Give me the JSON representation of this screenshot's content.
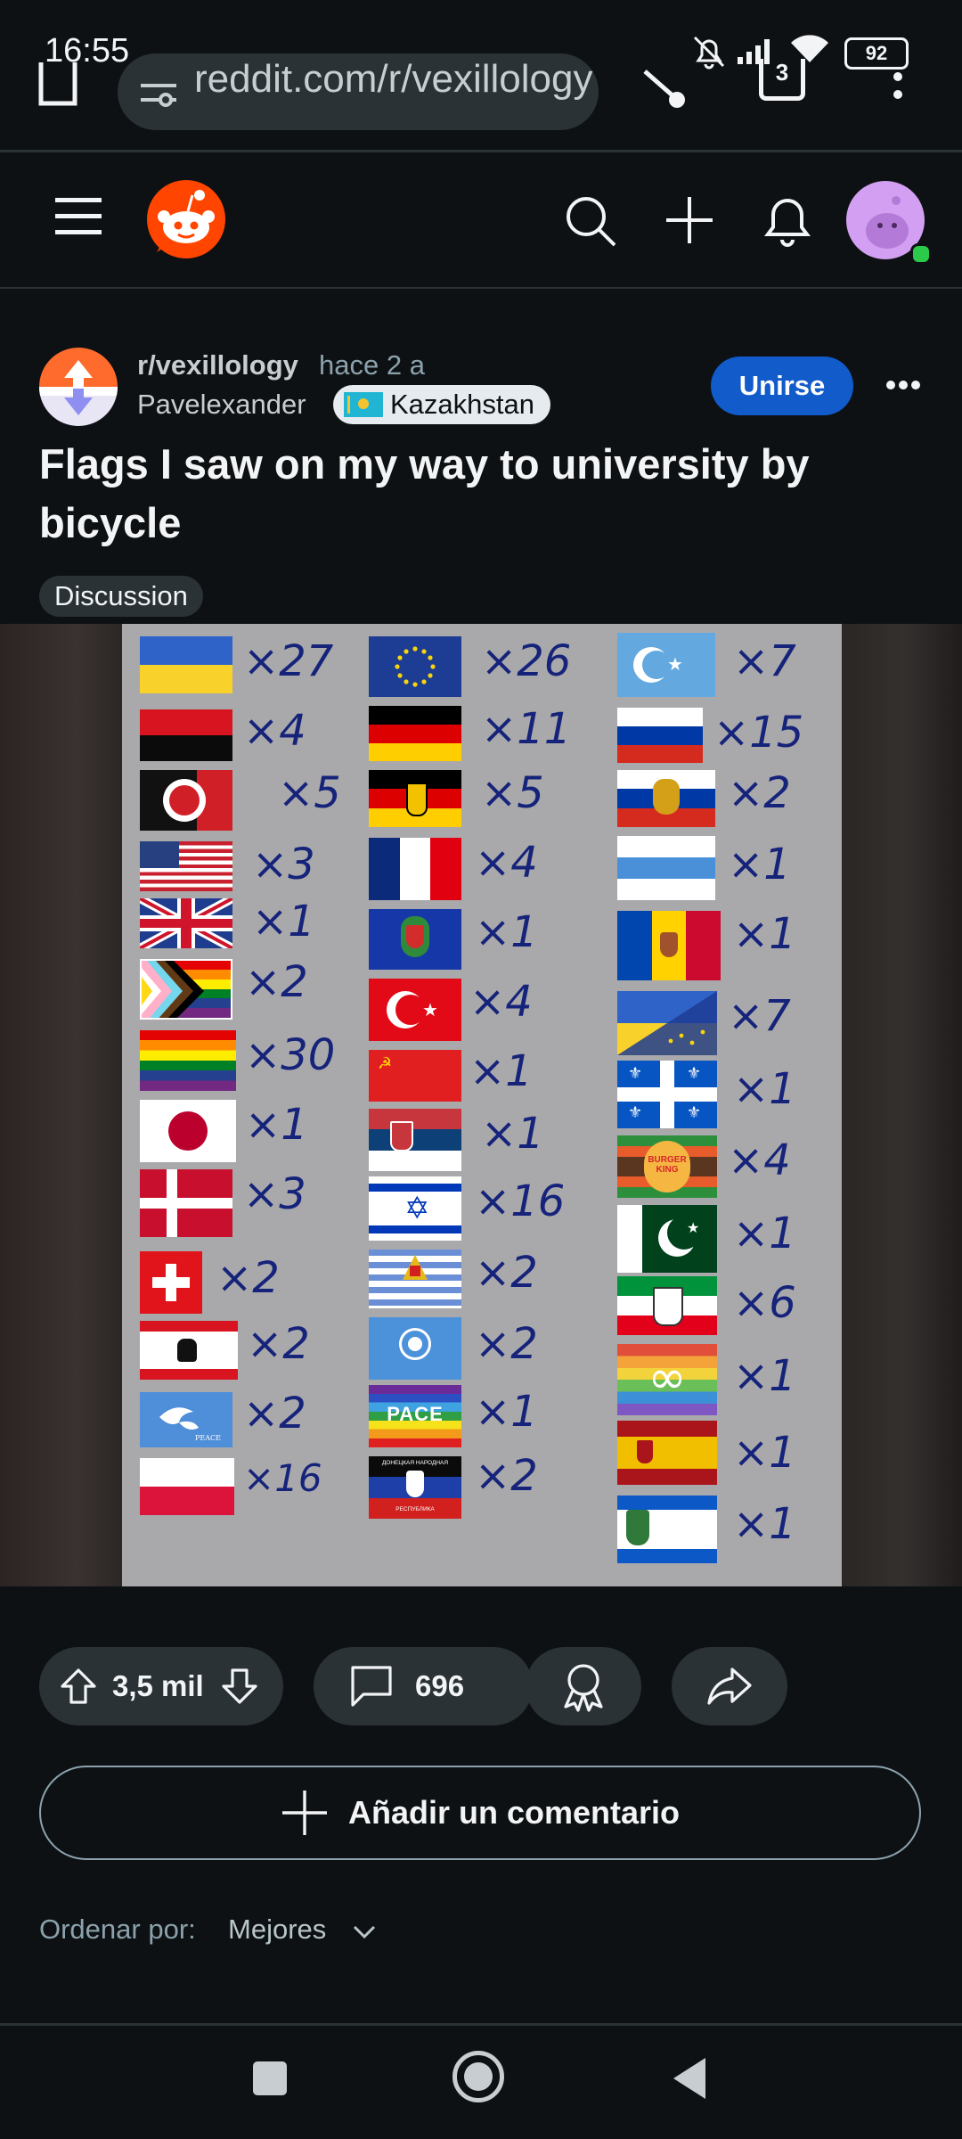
{
  "status_bar": {
    "time": "16:55",
    "battery": "92",
    "icons": [
      "mute-bell-icon",
      "signal-icon",
      "wifi-icon",
      "battery-icon"
    ]
  },
  "browser": {
    "url": "reddit.com/r/vexillology",
    "icons": [
      "home-icon",
      "tune-icon",
      "share-icon",
      "tabs-icon",
      "more-vert-icon"
    ],
    "tab_count": "3"
  },
  "reddit_header": {
    "icons": [
      "menu-icon",
      "reddit-logo",
      "search-icon",
      "plus-icon",
      "bell-icon",
      "avatar"
    ]
  },
  "post": {
    "subreddit": "r/vexillology",
    "time": "hace 2 a",
    "author": "Pavelexander",
    "flair": "Kazakhstan",
    "join_label": "Unirse",
    "title": "Flags I saw on my way to university by bicycle",
    "tag": "Discussion"
  },
  "flag_tally": {
    "col1": [
      {
        "flag": "Ukraine",
        "count": "×27"
      },
      {
        "flag": "Red-black",
        "count": "×4"
      },
      {
        "flag": "Antifa",
        "count": "×5"
      },
      {
        "flag": "USA",
        "count": "×3"
      },
      {
        "flag": "UK",
        "count": "×1"
      },
      {
        "flag": "Progress pride",
        "count": "×2"
      },
      {
        "flag": "Rainbow",
        "count": "×30"
      },
      {
        "flag": "Japan",
        "count": "×1"
      },
      {
        "flag": "Denmark",
        "count": "×3"
      },
      {
        "flag": "Switzerland",
        "count": "×2"
      },
      {
        "flag": "Berlin",
        "count": "×2"
      },
      {
        "flag": "Peace dove",
        "count": "×2"
      },
      {
        "flag": "Poland",
        "count": "×16"
      }
    ],
    "col2": [
      {
        "flag": "EU",
        "count": "×26"
      },
      {
        "flag": "Germany",
        "count": "×11"
      },
      {
        "flag": "Germany eagle",
        "count": "×5"
      },
      {
        "flag": "France",
        "count": "×4"
      },
      {
        "flag": "Coat of arms blue",
        "count": "×1"
      },
      {
        "flag": "Turkey",
        "count": "×4"
      },
      {
        "flag": "USSR",
        "count": "×1"
      },
      {
        "flag": "Serbia",
        "count": "×1"
      },
      {
        "flag": "Israel",
        "count": "×16"
      },
      {
        "flag": "Greek-striped",
        "count": "×2"
      },
      {
        "flag": "UN",
        "count": "×2"
      },
      {
        "flag": "PACE",
        "count": "×1"
      },
      {
        "flag": "DNR",
        "count": "×2"
      }
    ],
    "col3": [
      {
        "flag": "East Turkestan",
        "count": "×7"
      },
      {
        "flag": "Russia",
        "count": "×15"
      },
      {
        "flag": "Russia eagle",
        "count": "×2"
      },
      {
        "flag": "White-blue-white",
        "count": "×1"
      },
      {
        "flag": "Moldova",
        "count": "×1"
      },
      {
        "flag": "Ukraine-EU",
        "count": "×7"
      },
      {
        "flag": "Quebec",
        "count": "×1"
      },
      {
        "flag": "Burger King",
        "count": "×4"
      },
      {
        "flag": "Pakistan",
        "count": "×1"
      },
      {
        "flag": "NRW",
        "count": "×6"
      },
      {
        "flag": "Autism infinity",
        "count": "×1"
      },
      {
        "flag": "Spain",
        "count": "×1"
      },
      {
        "flag": "Blue-white-blue arms",
        "count": "×1"
      }
    ],
    "texts": {
      "burger": "BURGER KING",
      "pace": "PACE",
      "dnr": "ДОНЕЦКАЯ НАРОДНАЯ",
      "dnr2": "РЕСПУБЛИКА",
      "peace": "PEACE"
    }
  },
  "actions": {
    "votes": "3,5 mil",
    "comments": "696",
    "add_comment": "Añadir un comentario",
    "sort_label": "Ordenar por:",
    "sort_value": "Mejores"
  },
  "colors": {
    "bg": "#0e1113",
    "join": "#115bca",
    "reddit": "#ff4500"
  }
}
